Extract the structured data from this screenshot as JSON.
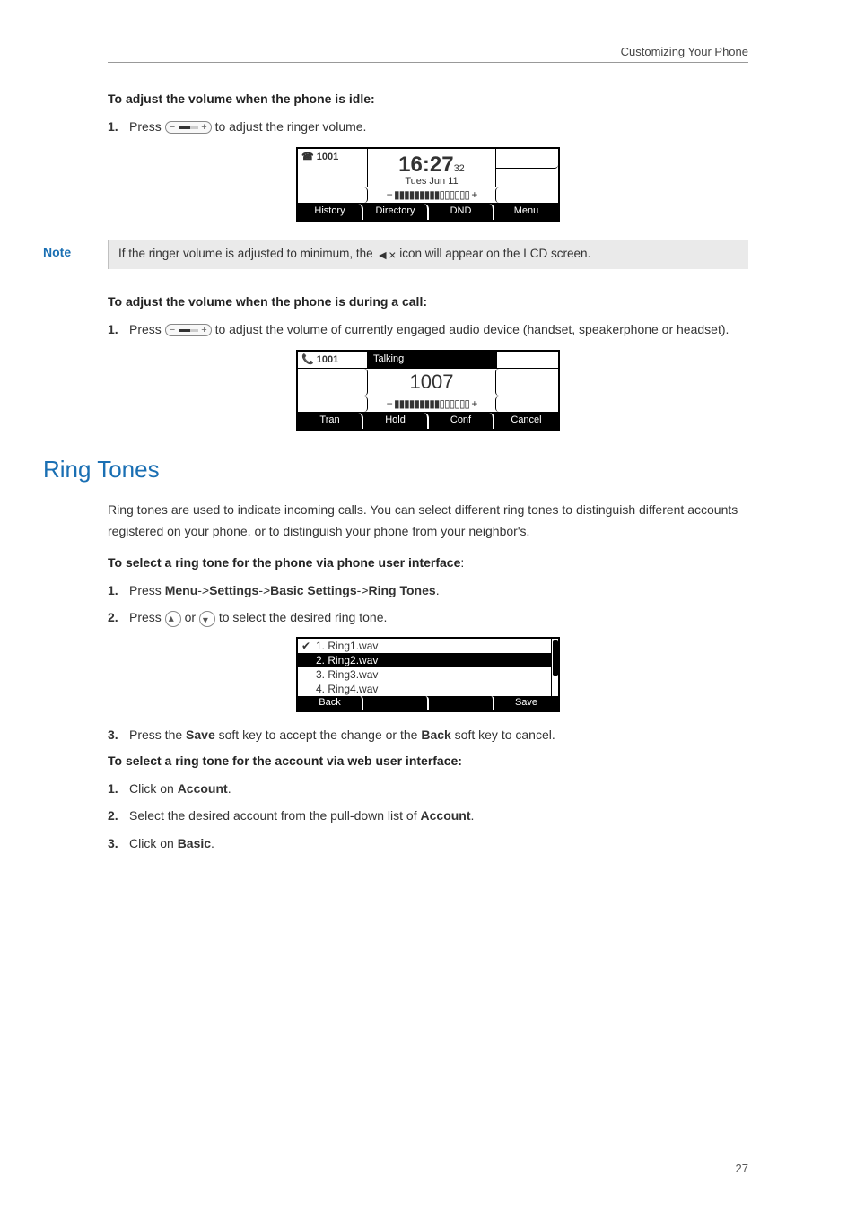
{
  "header": {
    "right_text": "Customizing Your Phone"
  },
  "idle_volume": {
    "heading": "To adjust the volume when the phone is idle:",
    "step1_num": "1.",
    "step1_pre": "Press ",
    "step1_post": " to adjust the ringer volume.",
    "lcd": {
      "account": "☎ 1001",
      "time": "16:27",
      "seconds": "32",
      "date": "Tues Jun 11",
      "volbar": "− ▮▮▮▮▮▮▮▮▮▯▯▯▯▯▯ +",
      "softkeys": [
        "History",
        "Directory",
        "DND",
        "Menu"
      ]
    }
  },
  "note": {
    "label": "Note",
    "text_pre": "If the ringer volume is adjusted to minimum, the ",
    "text_post": " icon will appear on the LCD screen.",
    "icon": "◄×"
  },
  "call_volume": {
    "heading": "To adjust the volume when the phone is during a call:",
    "step1_num": "1.",
    "step1_pre": "Press ",
    "step1_post": " to adjust the volume of currently engaged audio device (handset, speakerphone or headset).",
    "lcd": {
      "account": "📞 1001",
      "status": "Talking",
      "number": "1007",
      "volbar": "− ▮▮▮▮▮▮▮▮▮▯▯▯▯▯▯ +",
      "softkeys": [
        "Tran",
        "Hold",
        "Conf",
        "Cancel"
      ]
    }
  },
  "ringtones": {
    "title": "Ring Tones",
    "intro": "Ring tones are used to indicate incoming calls. You can select different ring tones to distinguish different accounts registered on your phone, or to distinguish your phone from your neighbor's.",
    "phone_ui_heading": "To select a ring tone for the phone via phone user interface",
    "phone_ui_heading_colon": ":",
    "step1_num": "1.",
    "step1_text_pre": "Press ",
    "step1_menu": "Menu",
    "step1_arrow1": "->",
    "step1_settings": "Settings",
    "step1_arrow2": "->",
    "step1_basic": "Basic Settings",
    "step1_arrow3": "->",
    "step1_ring": "Ring Tones",
    "step1_period": ".",
    "step2_num": "2.",
    "step2_pre": "Press ",
    "step2_or": " or ",
    "step2_post": " to select the desired ring tone.",
    "list": [
      {
        "check": "✔",
        "label": "1. Ring1.wav",
        "selected": false
      },
      {
        "check": "",
        "label": "2. Ring2.wav",
        "selected": true
      },
      {
        "check": "",
        "label": "3. Ring3.wav",
        "selected": false
      },
      {
        "check": "",
        "label": "4. Ring4.wav",
        "selected": false
      }
    ],
    "list_softkeys": {
      "back": "Back",
      "save": "Save"
    },
    "step3_num": "3.",
    "step3_pre": "Press the ",
    "step3_save": "Save",
    "step3_mid": " soft key to accept the change or the ",
    "step3_back": "Back",
    "step3_post": " soft key to cancel.",
    "web_heading": "To select a ring tone for the account via web user interface:",
    "w1_num": "1.",
    "w1_pre": "Click on ",
    "w1_account": "Account",
    "w1_period": ".",
    "w2_num": "2.",
    "w2_pre": "Select the desired account from the pull-down list of ",
    "w2_account": "Account",
    "w2_period": ".",
    "w3_num": "3.",
    "w3_pre": "Click on ",
    "w3_basic": "Basic",
    "w3_period": "."
  },
  "page_number": "27"
}
